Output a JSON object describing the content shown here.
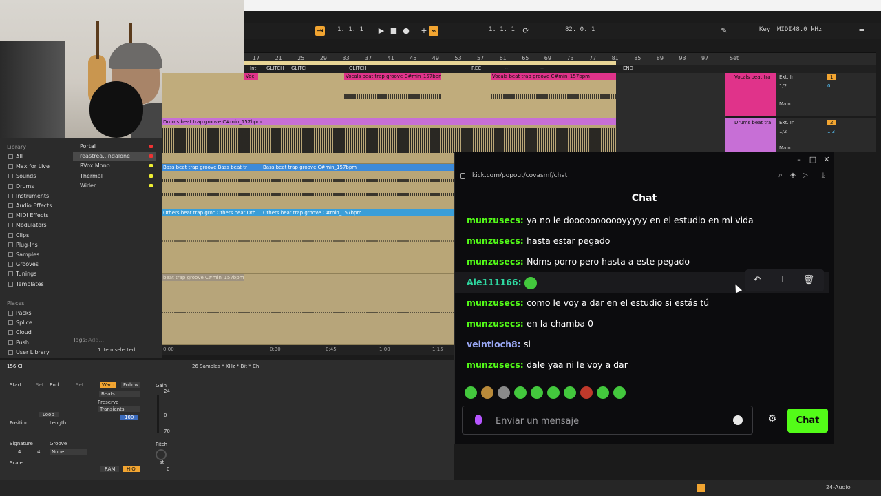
{
  "daw": {
    "transport": {
      "arrangement_position": "1.  1.  1",
      "loop_start": "1.  1.  1",
      "loop_length": "82.  0.  1",
      "key_label": "Key",
      "midi_label": "MIDI",
      "sample_rate": "48.0 kHz"
    },
    "ruler_bars": [
      "17",
      "21",
      "25",
      "29",
      "33",
      "37",
      "41",
      "45",
      "49",
      "53",
      "57",
      "61",
      "65",
      "69",
      "73",
      "77",
      "81",
      "85",
      "89",
      "93",
      "97"
    ],
    "ruler_set": "Set",
    "locators": [
      "Int",
      "GLITCH",
      "GLITCH",
      "GLITCH",
      "REC",
      "--",
      "--",
      "END"
    ],
    "clips": {
      "vocals": "Vocals beat trap groove C#min_157bpm",
      "vocals2": "Vocals beat trap groove C#min_157bpm",
      "drums": "Drums beat trap groove C#min_157bpm",
      "drums2": "Drums beat trap groove C",
      "bass": "Bass beat trap groove Bass beat tr",
      "bass2": "Bass beat trap groove C#min_157bpm",
      "others": "Others beat trap groc Others beat Oth",
      "others2": "Others beat trap groove C#min_157bpm",
      "beat": "beat trap groove C#min_157bpm"
    },
    "mixer": [
      {
        "name": "Vocals beat tra",
        "input": "Ext. In",
        "channel": "1/2",
        "num": "1",
        "vol": "0",
        "route": "Main"
      },
      {
        "name": "Drums beat tra",
        "input": "Ext. In",
        "channel": "1/2",
        "num": "2",
        "vol": "1.3",
        "route": "Main"
      }
    ],
    "time_ticks": [
      "0:00",
      "0:30",
      "0:45",
      "1:00",
      "1:15"
    ],
    "browser": {
      "library_label": "Library",
      "items": [
        "All",
        "Max for Live",
        "Sounds",
        "Drums",
        "Instruments",
        "Audio Effects",
        "MIDI Effects",
        "Modulators",
        "Clips",
        "Plug-Ins",
        "Samples",
        "Grooves",
        "Tunings",
        "Templates"
      ],
      "places_label": "Places",
      "places": [
        "Packs",
        "Splice",
        "Cloud",
        "Push",
        "User Library"
      ],
      "files": [
        "Portal",
        "reastrea...ndalone",
        "RVox Mono",
        "Thermal",
        "Wider"
      ],
      "tags_label": "Tags:",
      "tags_add": "Add...",
      "status": "1 item selected"
    },
    "clip_detail": {
      "title": "156 Cl.",
      "sample_info": "26 Samples  * KHz  *-Bit  * Ch",
      "start": "Start",
      "end": "End",
      "set": "Set",
      "warp": "Warp",
      "follow": "Follow",
      "warp_mode": "Beats",
      "preserve": "Preserve",
      "transients": "Transients",
      "amount": "100",
      "loop": "Loop",
      "position": "Position",
      "length": "Length",
      "signature": "Signature",
      "groove": "Groove",
      "sig_num": "4",
      "sig_den": "4",
      "groove_val": "None",
      "scale": "Scale",
      "gain": "Gain",
      "gain_top": "24",
      "gain_mid": "0",
      "gain_bot": "70",
      "pitch": "Pitch",
      "st": "st",
      "pitch_val": "0",
      "ram": "RAM",
      "hiq": "HiQ"
    },
    "status_right": "24-Audio"
  },
  "chat": {
    "url": "kick.com/popout/covasmf/chat",
    "header": "Chat",
    "messages": [
      {
        "user": "munzusecs",
        "color": "#53fc18",
        "text": "ya no le dooooooooooyyyyy en el estudio en mi vida"
      },
      {
        "user": "munzusecs",
        "color": "#53fc18",
        "text": "hasta estar pegado"
      },
      {
        "user": "munzusecs",
        "color": "#53fc18",
        "text": "Ndms porro pero hasta a este pegado"
      },
      {
        "user": "Ale111166",
        "color": "#2ed8a1",
        "text": ""
      },
      {
        "user": "munzusecs",
        "color": "#53fc18",
        "text": "como le voy a dar en el estudio si estás tú"
      },
      {
        "user": "munzusecs",
        "color": "#53fc18",
        "text": "en la chamba 0"
      },
      {
        "user": "veintioch8",
        "color": "#9aa8f5",
        "text": "si"
      },
      {
        "user": "munzusecs",
        "color": "#53fc18",
        "text": "dale yaa ni le voy a dar"
      }
    ],
    "input_placeholder": "Enviar un mensaje",
    "send_label": "Chat",
    "accent": "#53fc18"
  }
}
